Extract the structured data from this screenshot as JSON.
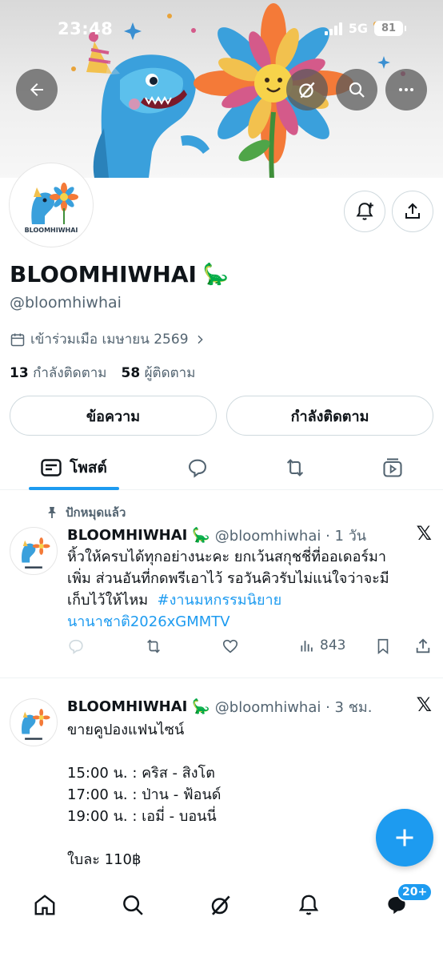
{
  "status_bar": {
    "time": "23:48",
    "network": "5G",
    "battery": "81"
  },
  "profile": {
    "name": "BLOOMHIWHAI",
    "name_emoji": "🦕",
    "handle": "@bloomhiwhai",
    "joined": "เข้าร่วมเมือ เมษายน 2569",
    "following_count": "13",
    "following_label": "กำลังติดตาม",
    "followers_count": "58",
    "followers_label": "ผู้ติดตาม",
    "avatar_logo_text": "BLOOMHIWHAI"
  },
  "actions": {
    "message_label": "ข้อความ",
    "following_button_label": "กำลังติดตาม"
  },
  "tabs": {
    "posts_label": "โพสต์"
  },
  "posts": [
    {
      "pinned_label": "ปักหมุดแล้ว",
      "name": "BLOOMHIWHAI",
      "emoji": "🦕",
      "handle_time": "@bloomhiwhai · 1 วัน",
      "text_line1": "หิ้วให้ครบได้ทุกอย่างนะคะ ยกเว้นสกุชชี่ที่ออเดอร์มา",
      "text_line2": "เพิ่ม ส่วนอันที่กดพรีเอาไว้ รอวันคิวรับไม่แน่ใจว่าจะมี",
      "text_line3": "เก็บไว้ให้ไหม",
      "hashtag_part1": "#งานมหกรรมนิยาย",
      "hashtag_part2": "นานาชาติ2026xGMMTV",
      "views": "843"
    },
    {
      "name": "BLOOMHIWHAI",
      "emoji": "🦕",
      "handle_time": "@bloomhiwhai · 3 ชม.",
      "line1": "ขายคูปองแฟนไซน์",
      "line2": "15:00 น. : คริส - สิงโต",
      "line3": "17:00 น. : ป่าน - ฟ้อนด์",
      "line4": "19:00 น. : เอมี่ - บอนนี่",
      "line5": "ใบละ 110฿"
    }
  ],
  "nav": {
    "messages_badge": "20+"
  },
  "colors": {
    "accent": "#1d9bf0",
    "text": "#0f1419",
    "muted": "#536471",
    "border": "#cfd9de"
  }
}
